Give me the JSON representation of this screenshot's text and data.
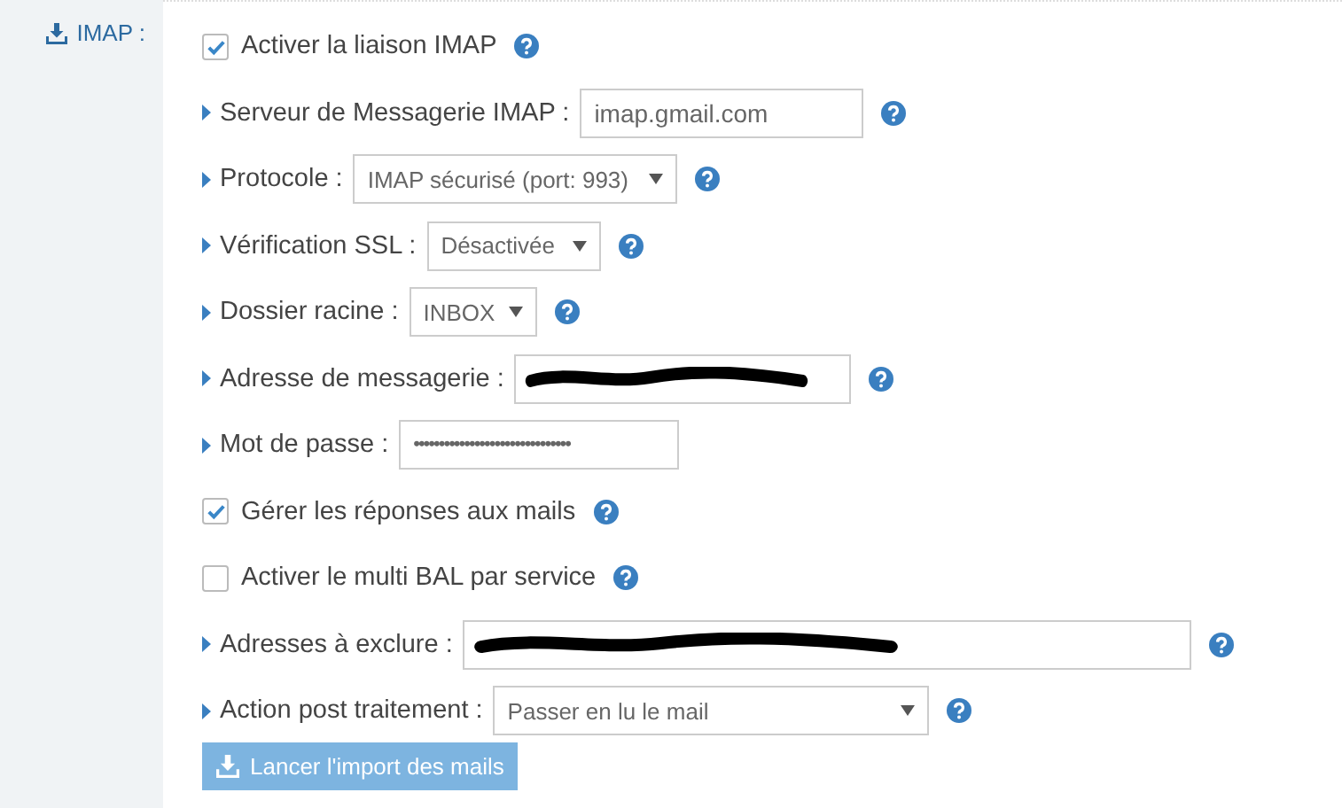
{
  "section": {
    "label": "IMAP :"
  },
  "rows": [
    {
      "kind": "checkbox",
      "label": "Activer la liaison IMAP",
      "checked": true,
      "help": true
    },
    {
      "kind": "text",
      "label": "Serveur de Messagerie IMAP :",
      "value": "imap.gmail.com",
      "help": true
    },
    {
      "kind": "select",
      "label": "Protocole :",
      "value": "IMAP sécurisé (port: 993)",
      "help": true
    },
    {
      "kind": "select",
      "label": "Vérification SSL :",
      "value": "Désactivée",
      "help": true
    },
    {
      "kind": "select",
      "label": "Dossier racine :",
      "value": "INBOX",
      "help": true
    },
    {
      "kind": "text",
      "label": "Adresse de messagerie :",
      "redacted": true,
      "help": true
    },
    {
      "kind": "password",
      "label": "Mot de passe :",
      "value": "•••••••••••••••••••••••••••••••",
      "help": false
    },
    {
      "kind": "checkbox",
      "label": "Gérer les réponses aux mails",
      "checked": true,
      "help": true
    },
    {
      "kind": "checkbox",
      "label": "Activer le multi BAL par service",
      "checked": false,
      "help": true
    },
    {
      "kind": "text",
      "label": "Adresses à exclure :",
      "redacted": true,
      "help": true
    },
    {
      "kind": "select",
      "label": "Action post traitement :",
      "value": "Passer en lu le mail",
      "help": true
    }
  ],
  "button": {
    "label": "Lancer l'import des mails"
  }
}
